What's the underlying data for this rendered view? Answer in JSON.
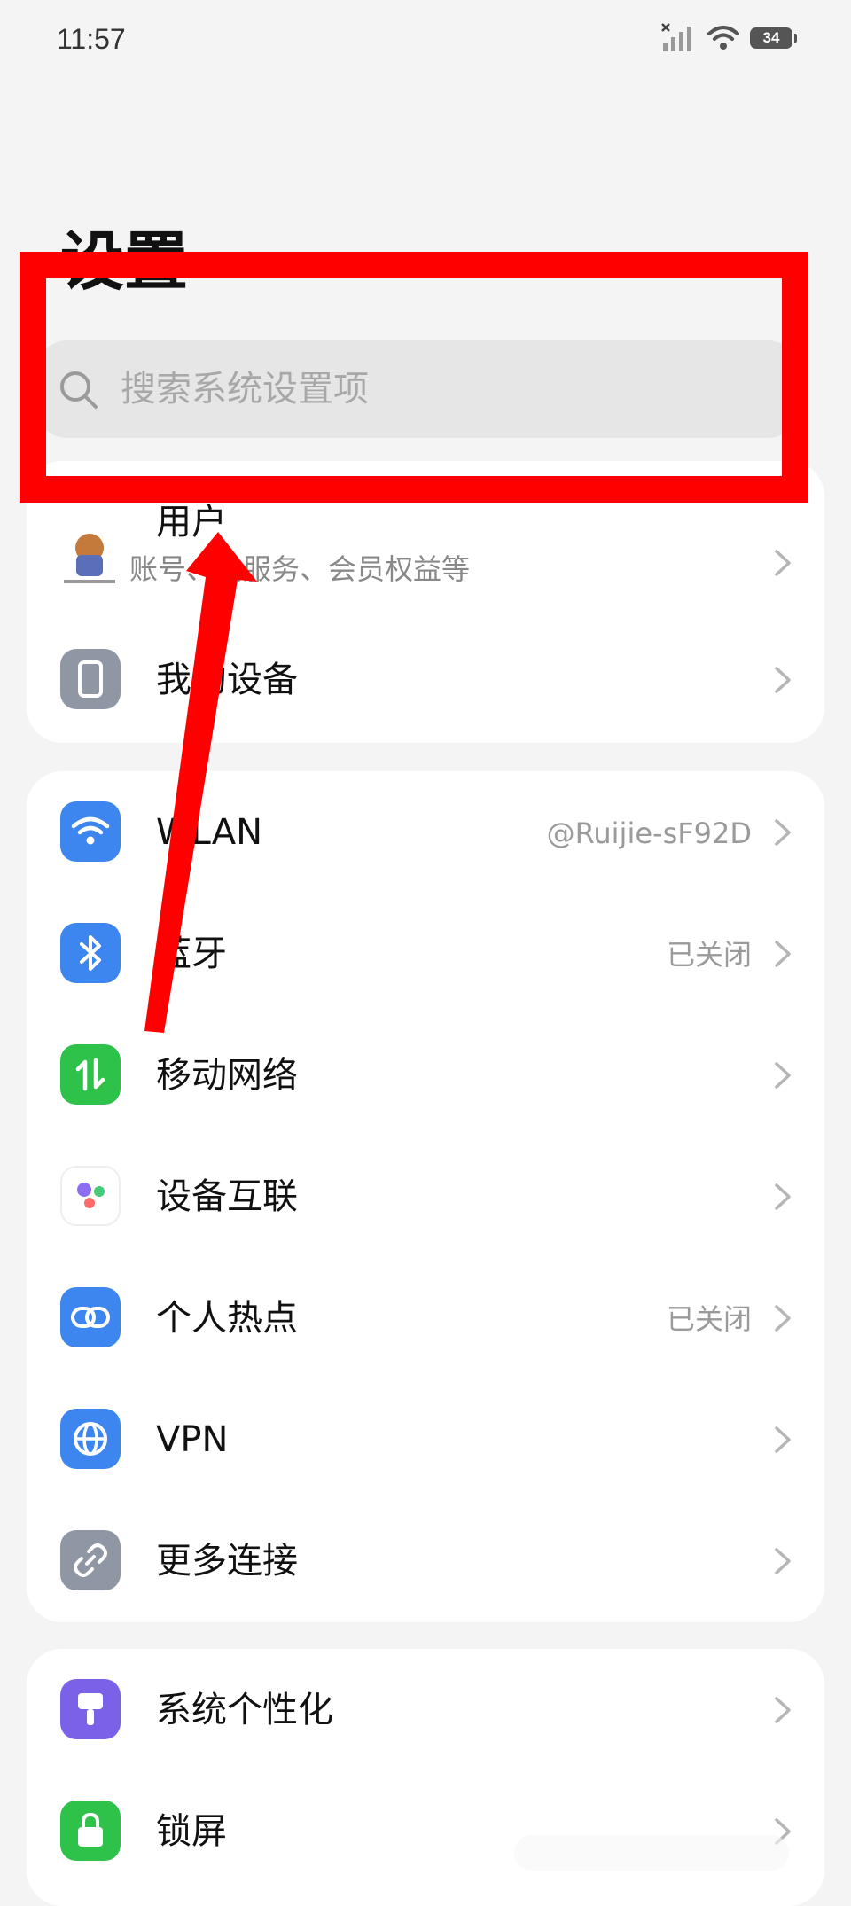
{
  "status_bar": {
    "time": "11:57",
    "battery_level": "34"
  },
  "header": {
    "title": "设置"
  },
  "search": {
    "placeholder": "搜索系统设置项"
  },
  "account": {
    "title": "用户",
    "subtitle": "账号、云服务、会员权益等"
  },
  "groups": [
    {
      "items": [
        {
          "label": "我的设备",
          "value": "",
          "icon": "device-icon",
          "color": "#8e97a3"
        }
      ]
    },
    {
      "items": [
        {
          "label": "WLAN",
          "value": "@Ruijie-sF92D",
          "icon": "wifi-icon",
          "color": "#3d86f0"
        },
        {
          "label": "蓝牙",
          "value": "已关闭",
          "icon": "bluetooth-icon",
          "color": "#3d86f0"
        },
        {
          "label": "移动网络",
          "value": "",
          "icon": "mobile-data-icon",
          "color": "#2ec24a"
        },
        {
          "label": "设备互联",
          "value": "",
          "icon": "device-connect-icon",
          "color": "#ffffff"
        },
        {
          "label": "个人热点",
          "value": "已关闭",
          "icon": "hotspot-icon",
          "color": "#3d86f0"
        },
        {
          "label": "VPN",
          "value": "",
          "icon": "globe-icon",
          "color": "#3d86f0"
        },
        {
          "label": "更多连接",
          "value": "",
          "icon": "link-icon",
          "color": "#8e97a3"
        }
      ]
    },
    {
      "items": [
        {
          "label": "系统个性化",
          "value": "",
          "icon": "brush-icon",
          "color": "#7b61e8"
        },
        {
          "label": "锁屏",
          "value": "",
          "icon": "lock-icon",
          "color": "#2ec24a"
        }
      ]
    }
  ],
  "annotation": {
    "color": "#ff0000"
  }
}
